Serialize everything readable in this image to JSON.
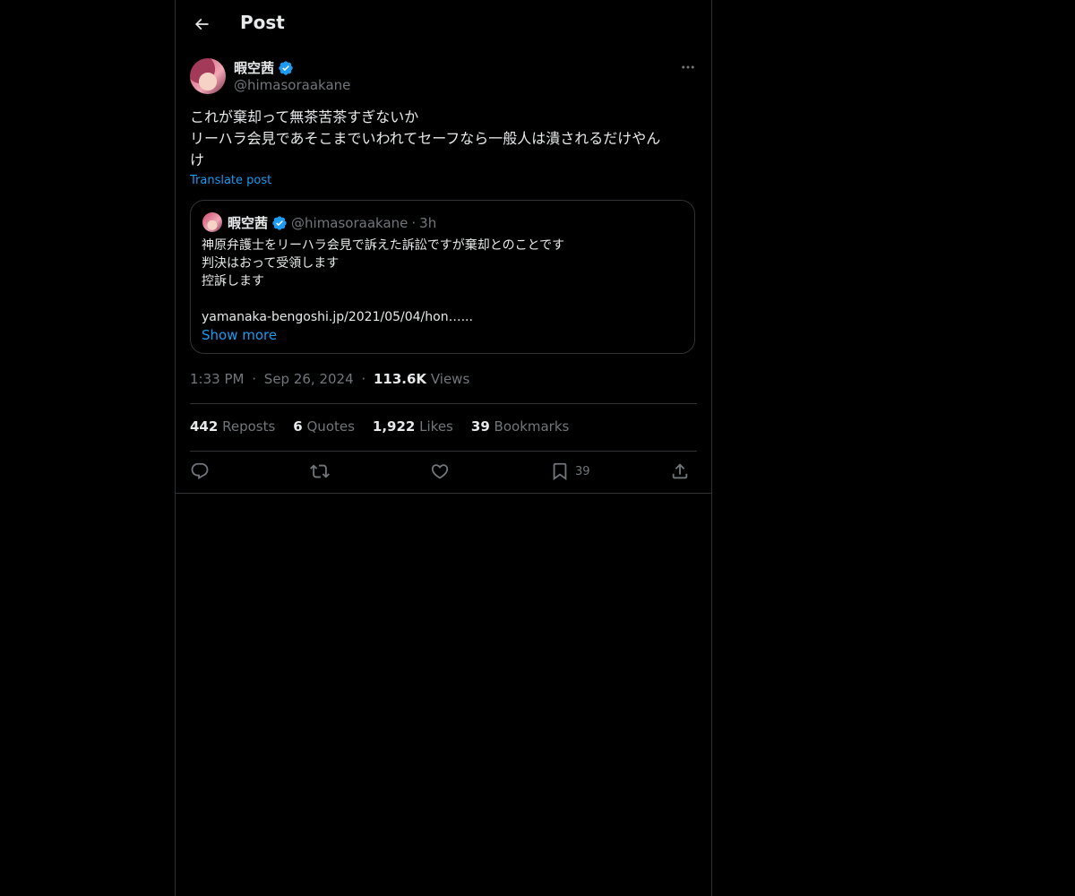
{
  "header": {
    "title": "Post"
  },
  "post": {
    "author": {
      "name": "暇空茜",
      "handle": "@himasoraakane",
      "verified": true
    },
    "text_lines": [
      "これが棄却って無茶苦茶すぎないか",
      "リーハラ会見であそこまでいわれてセーフなら一般人は潰されるだけやん",
      "け"
    ],
    "translate_label": "Translate post",
    "quote": {
      "name": "暇空茜",
      "handle": "@himasoraakane",
      "separator": "·",
      "time": "3h",
      "lines": [
        "神原弁護士をリーハラ会見で訴えた訴訟ですが棄却とのことです",
        "判決はおって受領します",
        "控訴します",
        "",
        "yamanaka-bengoshi.jp/2021/05/04/hon…..."
      ],
      "show_more": "Show more"
    },
    "time": "1:33 PM",
    "date": "Sep 26, 2024",
    "dot": "·",
    "views_count": "113.6K",
    "views_label": "Views",
    "stats": {
      "reposts_count": "442",
      "reposts_label": "Reposts",
      "quotes_count": "6",
      "quotes_label": "Quotes",
      "likes_count": "1,922",
      "likes_label": "Likes",
      "bookmarks_count": "39",
      "bookmarks_label": "Bookmarks"
    },
    "actions": {
      "bookmark_count": "39"
    }
  },
  "colors": {
    "background": "#000000",
    "text": "#e7e9ea",
    "muted": "#71767b",
    "accent": "#1d9bf0",
    "border": "#2f3336"
  }
}
